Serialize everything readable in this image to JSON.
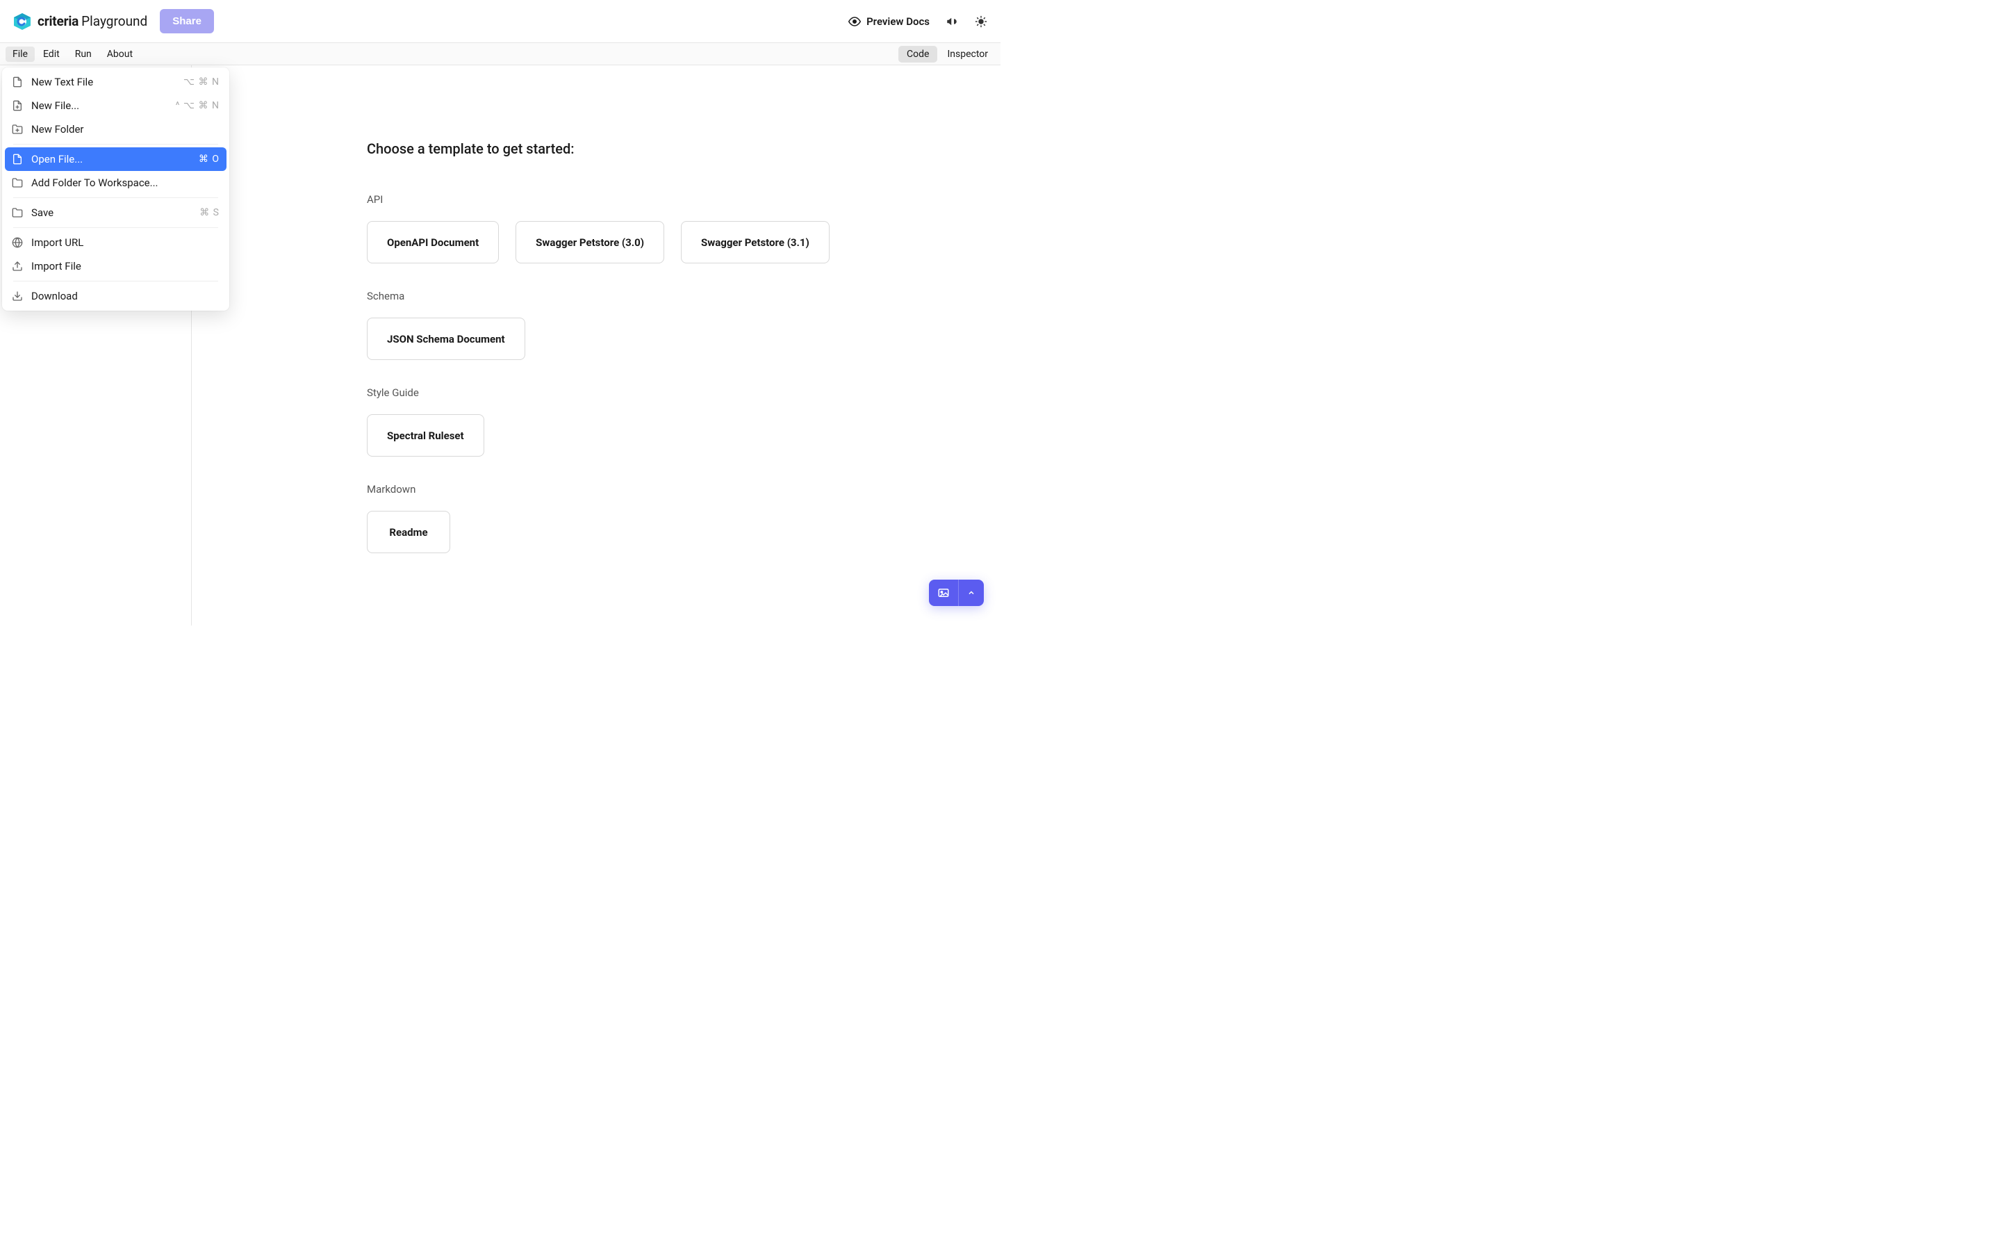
{
  "header": {
    "brand_main": "criteria",
    "brand_sub": "Playground",
    "share_label": "Share",
    "preview_label": "Preview Docs"
  },
  "menubar": {
    "items": [
      "File",
      "Edit",
      "Run",
      "About"
    ],
    "active_index": 0,
    "view_tabs": [
      "Code",
      "Inspector"
    ],
    "view_active_index": 0
  },
  "file_menu": {
    "items": [
      {
        "label": "New Text File",
        "shortcut": "⌥ ⌘ N",
        "icon": "file",
        "highlighted": false,
        "sep_after": false
      },
      {
        "label": "New File...",
        "shortcut": "^ ⌥ ⌘ N",
        "icon": "file-plus",
        "highlighted": false,
        "sep_after": false
      },
      {
        "label": "New Folder",
        "shortcut": "",
        "icon": "folder-plus",
        "highlighted": false,
        "sep_after": true
      },
      {
        "label": "Open File...",
        "shortcut": "⌘ O",
        "icon": "file",
        "highlighted": true,
        "sep_after": false
      },
      {
        "label": "Add Folder To Workspace...",
        "shortcut": "",
        "icon": "folder",
        "highlighted": false,
        "sep_after": true
      },
      {
        "label": "Save",
        "shortcut": "⌘ S",
        "icon": "folder",
        "highlighted": false,
        "sep_after": true
      },
      {
        "label": "Import URL",
        "shortcut": "",
        "icon": "globe",
        "highlighted": false,
        "sep_after": false
      },
      {
        "label": "Import File",
        "shortcut": "",
        "icon": "upload",
        "highlighted": false,
        "sep_after": true
      },
      {
        "label": "Download",
        "shortcut": "",
        "icon": "download",
        "highlighted": false,
        "sep_after": false
      }
    ]
  },
  "main": {
    "title": "Choose a template to get started:",
    "sections": [
      {
        "label": "API",
        "cards": [
          "OpenAPI Document",
          "Swagger Petstore (3.0)",
          "Swagger Petstore (3.1)"
        ]
      },
      {
        "label": "Schema",
        "cards": [
          "JSON Schema Document"
        ]
      },
      {
        "label": "Style Guide",
        "cards": [
          "Spectral Ruleset"
        ]
      },
      {
        "label": "Markdown",
        "cards": [
          "Readme"
        ]
      }
    ]
  }
}
